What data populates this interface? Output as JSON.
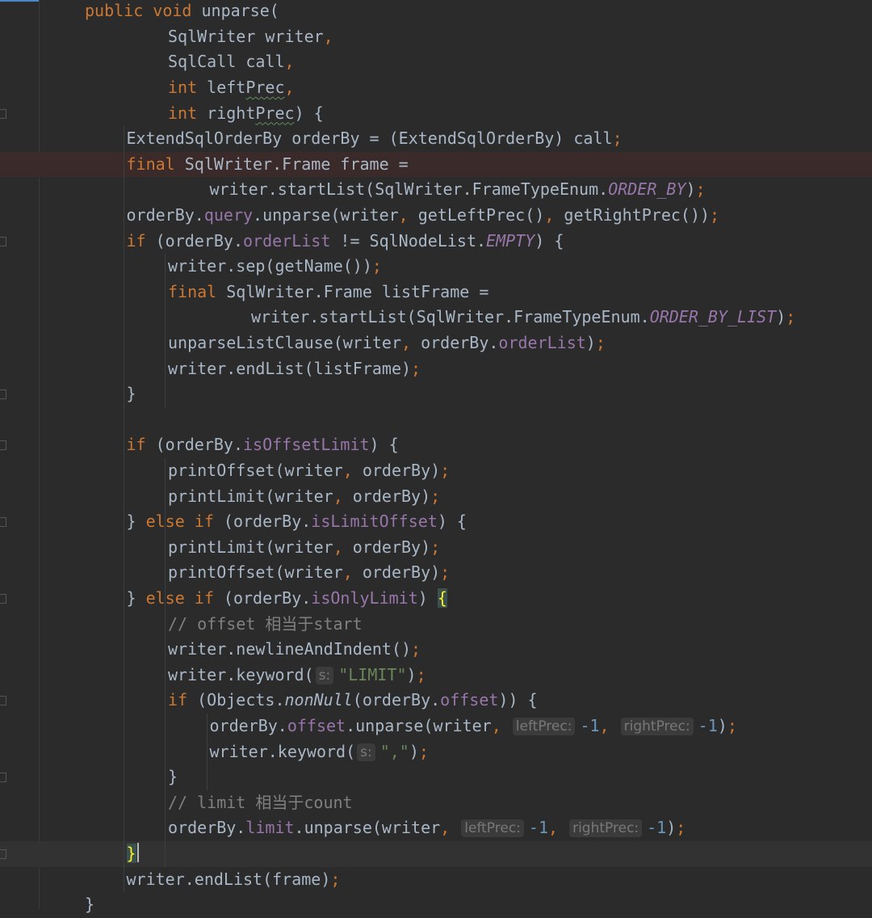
{
  "editor": {
    "lines": [
      {
        "indent": 0,
        "parts": [
          [
            "kw",
            "public void "
          ],
          [
            "",
            "unparse("
          ]
        ]
      },
      {
        "indent": 2,
        "parts": [
          [
            "",
            "SqlWriter writer"
          ],
          [
            "punc",
            ","
          ]
        ]
      },
      {
        "indent": 2,
        "parts": [
          [
            "",
            "SqlCall call"
          ],
          [
            "punc",
            ","
          ]
        ]
      },
      {
        "indent": 2,
        "parts": [
          [
            "kw",
            "int "
          ],
          [
            "",
            "left"
          ],
          [
            "squig",
            "Prec"
          ],
          [
            "punc",
            ","
          ]
        ]
      },
      {
        "indent": 2,
        "parts": [
          [
            "kw",
            "int "
          ],
          [
            "",
            "right"
          ],
          [
            "squig",
            "Prec"
          ],
          [
            "",
            ") {"
          ]
        ]
      },
      {
        "indent": 1,
        "parts": [
          [
            "",
            "ExtendSqlOrderBy orderBy = (ExtendSqlOrderBy) call"
          ],
          [
            "punc",
            ";"
          ]
        ]
      },
      {
        "indent": 1,
        "parts": [
          [
            "kw",
            "final "
          ],
          [
            "",
            "SqlWriter.Frame frame ="
          ]
        ]
      },
      {
        "indent": 3,
        "parts": [
          [
            "",
            "writer.startList(SqlWriter.FrameTypeEnum."
          ],
          [
            "cst",
            "ORDER_BY"
          ],
          [
            "",
            ")"
          ],
          [
            "punc",
            ";"
          ]
        ]
      },
      {
        "indent": 1,
        "parts": [
          [
            "",
            "orderBy."
          ],
          [
            "fld",
            "query"
          ],
          [
            "",
            ".unparse(writer"
          ],
          [
            "punc",
            ", "
          ],
          [
            "",
            "getLeftPrec()"
          ],
          [
            "punc",
            ", "
          ],
          [
            "",
            "getRightPrec())"
          ],
          [
            "punc",
            ";"
          ]
        ]
      },
      {
        "indent": 1,
        "parts": [
          [
            "kw",
            "if "
          ],
          [
            "",
            "(orderBy."
          ],
          [
            "fld",
            "orderList"
          ],
          [
            "",
            " != SqlNodeList."
          ],
          [
            "cst",
            "EMPTY"
          ],
          [
            "",
            ") {"
          ]
        ]
      },
      {
        "indent": 2,
        "parts": [
          [
            "",
            "writer.sep(getName())"
          ],
          [
            "punc",
            ";"
          ]
        ]
      },
      {
        "indent": 2,
        "parts": [
          [
            "kw",
            "final "
          ],
          [
            "",
            "SqlWriter.Frame listFrame ="
          ]
        ]
      },
      {
        "indent": 4,
        "parts": [
          [
            "",
            "writer.startList(SqlWriter.FrameTypeEnum."
          ],
          [
            "cst",
            "ORDER_BY_LIST"
          ],
          [
            "",
            ")"
          ],
          [
            "punc",
            ";"
          ]
        ]
      },
      {
        "indent": 2,
        "parts": [
          [
            "",
            "unparseListClause(writer"
          ],
          [
            "punc",
            ", "
          ],
          [
            "",
            "orderBy."
          ],
          [
            "fld",
            "orderList"
          ],
          [
            "",
            ")"
          ],
          [
            "punc",
            ";"
          ]
        ]
      },
      {
        "indent": 2,
        "parts": [
          [
            "",
            "writer.endList(listFrame)"
          ],
          [
            "punc",
            ";"
          ]
        ]
      },
      {
        "indent": 1,
        "parts": [
          [
            "",
            "}"
          ]
        ]
      },
      {
        "indent": 0,
        "parts": []
      },
      {
        "indent": 1,
        "parts": [
          [
            "kw",
            "if "
          ],
          [
            "",
            "(orderBy."
          ],
          [
            "fld",
            "isOffsetLimit"
          ],
          [
            "",
            ") {"
          ]
        ]
      },
      {
        "indent": 2,
        "parts": [
          [
            "",
            "printOffset(writer"
          ],
          [
            "punc",
            ", "
          ],
          [
            "",
            "orderBy)"
          ],
          [
            "punc",
            ";"
          ]
        ]
      },
      {
        "indent": 2,
        "parts": [
          [
            "",
            "printLimit(writer"
          ],
          [
            "punc",
            ", "
          ],
          [
            "",
            "orderBy)"
          ],
          [
            "punc",
            ";"
          ]
        ]
      },
      {
        "indent": 1,
        "parts": [
          [
            "",
            "} "
          ],
          [
            "kw",
            "else if "
          ],
          [
            "",
            "(orderBy."
          ],
          [
            "fld",
            "isLimitOffset"
          ],
          [
            "",
            ") {"
          ]
        ]
      },
      {
        "indent": 2,
        "parts": [
          [
            "",
            "printLimit(writer"
          ],
          [
            "punc",
            ", "
          ],
          [
            "",
            "orderBy)"
          ],
          [
            "punc",
            ";"
          ]
        ]
      },
      {
        "indent": 2,
        "parts": [
          [
            "",
            "printOffset(writer"
          ],
          [
            "punc",
            ", "
          ],
          [
            "",
            "orderBy)"
          ],
          [
            "punc",
            ";"
          ]
        ]
      },
      {
        "indent": 1,
        "parts": [
          [
            "",
            "} "
          ],
          [
            "kw",
            "else if "
          ],
          [
            "",
            "(orderBy."
          ],
          [
            "fld",
            "isOnlyLimit"
          ],
          [
            "",
            ") "
          ],
          [
            "brace-match",
            "{"
          ]
        ]
      },
      {
        "indent": 2,
        "parts": [
          [
            "cmt",
            "// offset 相当于start"
          ]
        ]
      },
      {
        "indent": 2,
        "parts": [
          [
            "",
            "writer.newlineAndIndent()"
          ],
          [
            "punc",
            ";"
          ]
        ]
      },
      {
        "indent": 2,
        "parts": [
          [
            "",
            "writer.keyword("
          ],
          [
            "hint",
            "s:"
          ],
          [
            "str",
            "\"LIMIT\""
          ],
          [
            "",
            ")"
          ],
          [
            "punc",
            ";"
          ]
        ]
      },
      {
        "indent": 2,
        "parts": [
          [
            "kw",
            "if "
          ],
          [
            "",
            "(Objects."
          ],
          [
            "stat",
            "nonNull"
          ],
          [
            "",
            "(orderBy."
          ],
          [
            "fld",
            "offset"
          ],
          [
            "",
            ")) {"
          ]
        ]
      },
      {
        "indent": 3,
        "parts": [
          [
            "",
            "orderBy."
          ],
          [
            "fld",
            "offset"
          ],
          [
            "",
            ".unparse(writer"
          ],
          [
            "punc",
            ", "
          ],
          [
            "hint",
            "leftPrec:"
          ],
          [
            "num",
            "-1"
          ],
          [
            "punc",
            ", "
          ],
          [
            "hint",
            "rightPrec:"
          ],
          [
            "num",
            "-1"
          ],
          [
            "",
            ")"
          ],
          [
            "punc",
            ";"
          ]
        ]
      },
      {
        "indent": 3,
        "parts": [
          [
            "",
            "writer.keyword("
          ],
          [
            "hint",
            "s:"
          ],
          [
            "str",
            "\",\""
          ],
          [
            "",
            ")"
          ],
          [
            "punc",
            ";"
          ]
        ]
      },
      {
        "indent": 2,
        "parts": [
          [
            "",
            "}"
          ]
        ]
      },
      {
        "indent": 2,
        "parts": [
          [
            "cmt",
            "// limit 相当于count"
          ]
        ]
      },
      {
        "indent": 2,
        "parts": [
          [
            "",
            "orderBy."
          ],
          [
            "fld",
            "limit"
          ],
          [
            "",
            ".unparse(writer"
          ],
          [
            "punc",
            ", "
          ],
          [
            "hint",
            "leftPrec:"
          ],
          [
            "num",
            "-1"
          ],
          [
            "punc",
            ", "
          ],
          [
            "hint",
            "rightPrec:"
          ],
          [
            "num",
            "-1"
          ],
          [
            "",
            ")"
          ],
          [
            "punc",
            ";"
          ]
        ]
      },
      {
        "indent": 1,
        "parts": [
          [
            "brace-match",
            "}"
          ],
          [
            "caret",
            ""
          ]
        ]
      },
      {
        "indent": 1,
        "parts": [
          [
            "",
            "writer.endList(frame)"
          ],
          [
            "punc",
            ";"
          ]
        ]
      },
      {
        "indent": 0,
        "parts": [
          [
            "",
            "}"
          ]
        ]
      }
    ],
    "highlighted_error_line": 6,
    "current_line": 33
  }
}
